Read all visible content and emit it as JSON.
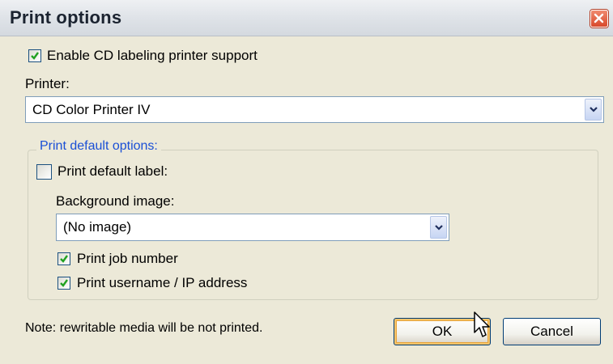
{
  "dialog": {
    "title": "Print options"
  },
  "enable_cd": {
    "label": "Enable CD labeling printer support",
    "checked": true
  },
  "printer": {
    "label": "Printer:",
    "value": "CD Color Printer IV"
  },
  "group": {
    "title": "Print default options:",
    "print_default_label": {
      "label": "Print default label:",
      "checked": false
    },
    "background_image": {
      "label": "Background image:",
      "value": "(No image)"
    },
    "print_job_number": {
      "label": "Print job number",
      "checked": true
    },
    "print_username": {
      "label": "Print username / IP address",
      "checked": true
    }
  },
  "note": "Note: rewritable media will be not printed.",
  "buttons": {
    "ok": "OK",
    "cancel": "Cancel"
  },
  "colors": {
    "group_title": "#1a4fd6",
    "check_mark": "#21a121",
    "close_button": "#d8492b"
  }
}
